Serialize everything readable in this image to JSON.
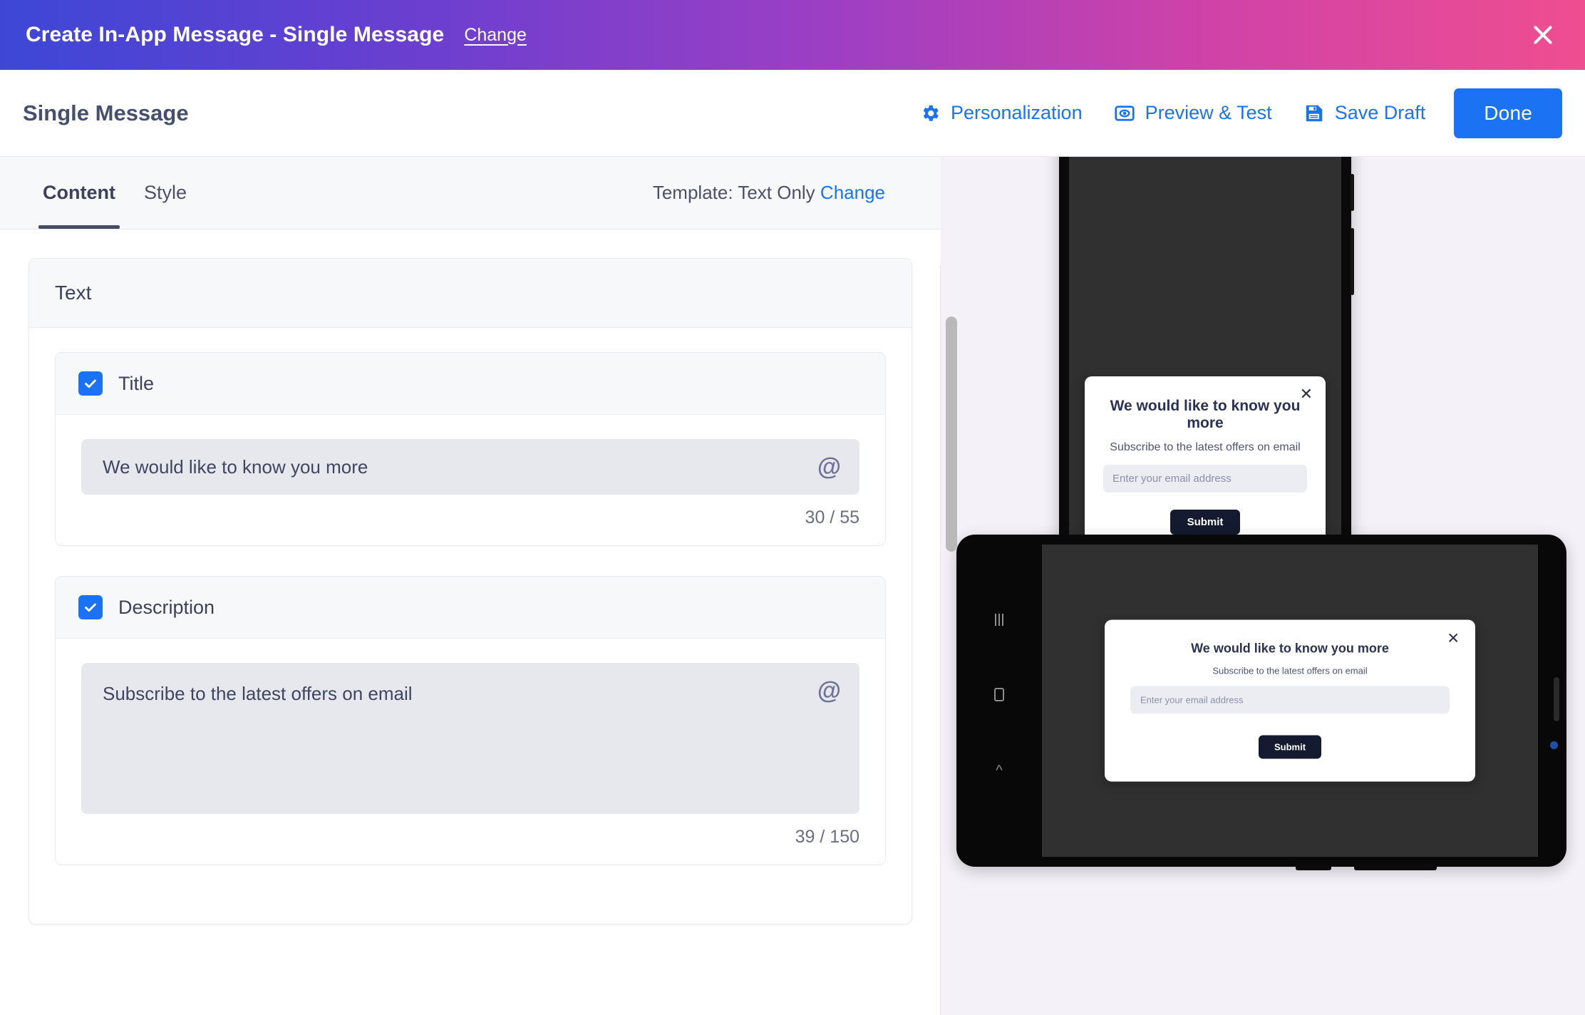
{
  "topbar": {
    "title": "Create In-App Message - Single Message",
    "change_label": "Change",
    "close_icon": "close-icon"
  },
  "actionbar": {
    "page_title": "Single Message",
    "personalization_label": "Personalization",
    "preview_test_label": "Preview & Test",
    "save_draft_label": "Save Draft",
    "done_label": "Done",
    "accent_color": "#1b72f2"
  },
  "editor": {
    "tabs": [
      {
        "label": "Content",
        "active": true
      },
      {
        "label": "Style",
        "active": false
      }
    ],
    "template": {
      "prefix": "Template: Text Only",
      "change_label": "Change"
    },
    "text_card": {
      "heading": "Text",
      "fields": [
        {
          "label": "Title",
          "checked": true,
          "value": "We would like to know you more",
          "counter": "30 / 55",
          "personalize_icon": "at-icon"
        },
        {
          "label": "Description",
          "checked": true,
          "value": "Subscribe to the latest offers on email",
          "counter": "39 / 150",
          "personalize_icon": "at-icon"
        }
      ]
    }
  },
  "preview": {
    "background_color": "#f4f2f8",
    "message": {
      "title": "We would like to know you more",
      "subtitle": "Subscribe to the latest offers on email",
      "input_placeholder": "Enter your email address",
      "submit_label": "Submit",
      "close_icon": "close-icon",
      "submit_color": "#141a30"
    },
    "phone": {
      "nav": [
        "recents-icon",
        "home-icon",
        "back-icon"
      ]
    },
    "tablet": {
      "nav": [
        "recents-icon",
        "home-icon",
        "back-icon"
      ]
    }
  }
}
